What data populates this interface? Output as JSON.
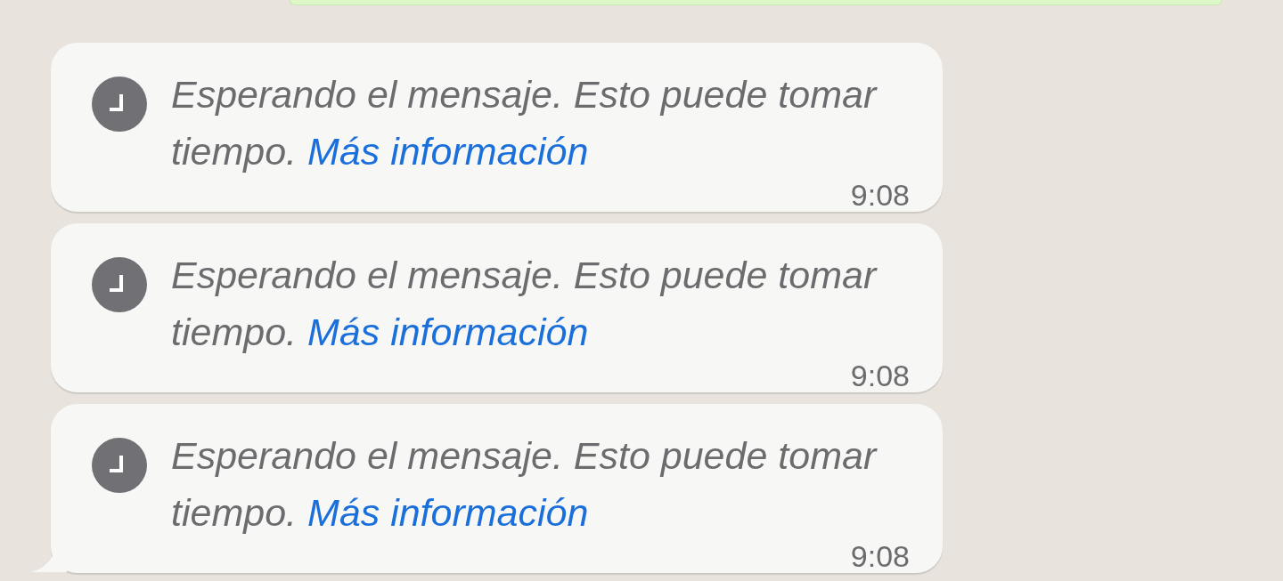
{
  "messages": [
    {
      "text": "Esperando el mensaje. Esto puede tomar tiempo.",
      "link": "Más información",
      "time": "9:08",
      "tail": false
    },
    {
      "text": "Esperando el mensaje. Esto puede tomar tiempo.",
      "link": "Más información",
      "time": "9:08",
      "tail": false
    },
    {
      "text": "Esperando el mensaje. Esto puede tomar tiempo.",
      "link": "Más información",
      "time": "9:08",
      "tail": true
    }
  ]
}
